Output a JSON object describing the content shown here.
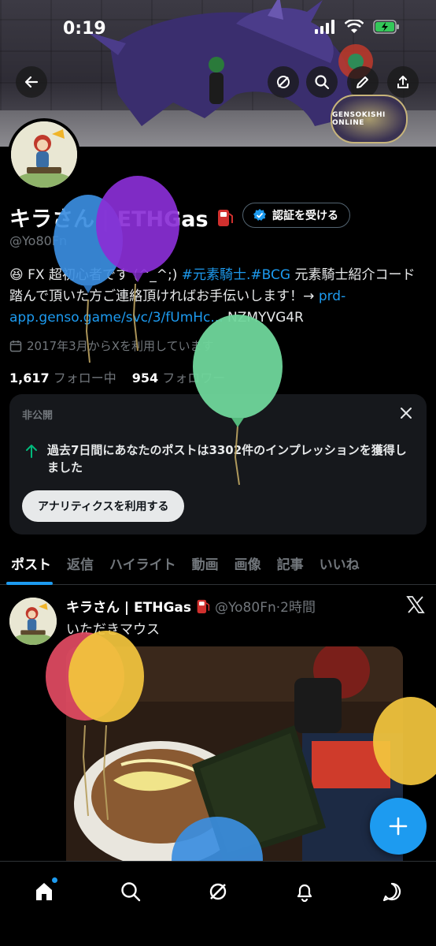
{
  "status_bar": {
    "time": "0:19"
  },
  "banner": {
    "game_logo_text": "GENSOKISHI ONLINE"
  },
  "profile": {
    "display_name": "キラさん | ETHGas",
    "handle": "@Yo80Fn",
    "verify_label": "認証を受ける",
    "bio_prefix": "😆 FX 超初心者です (^_^;) ",
    "bio_hashtags": "#元素騎士.#BCG",
    "bio_suffix": " 元素騎士紹介コード踏んで頂いた方ご連絡頂ければお手伝いします！→ ",
    "bio_link": "prd-app.genso.game/svc/3/fUmHc...",
    "bio_code": " NZMYVG4R",
    "joined": "2017年3月からXを利用しています",
    "following_count": "1,617",
    "following_label": "フォロー中",
    "followers_count": "954",
    "followers_label": "フォロワー"
  },
  "analytics_card": {
    "private_label": "非公開",
    "message": "過去7日間にあなたのポストは3302件のインプレッションを獲得しました",
    "button_label": "アナリティクスを利用する"
  },
  "tabs": [
    {
      "label": "ポスト",
      "active": true
    },
    {
      "label": "返信",
      "active": false
    },
    {
      "label": "ハイライト",
      "active": false
    },
    {
      "label": "動画",
      "active": false
    },
    {
      "label": "画像",
      "active": false
    },
    {
      "label": "記事",
      "active": false
    },
    {
      "label": "いいね",
      "active": false
    }
  ],
  "post": {
    "author": "キラさん | ETHGas",
    "handle_time": "@Yo80Fn·2時間",
    "text": "いただきマウス"
  },
  "colors": {
    "accent": "#1d9bf0",
    "background": "#000000",
    "card": "#16181c",
    "muted": "#71767b"
  },
  "icons": {
    "banner": [
      "back-arrow-icon",
      "grok-icon",
      "search-icon",
      "edit-icon",
      "share-icon"
    ],
    "nav": [
      "home-icon",
      "search-icon",
      "grok-icon",
      "bell-icon",
      "message-icon"
    ]
  }
}
